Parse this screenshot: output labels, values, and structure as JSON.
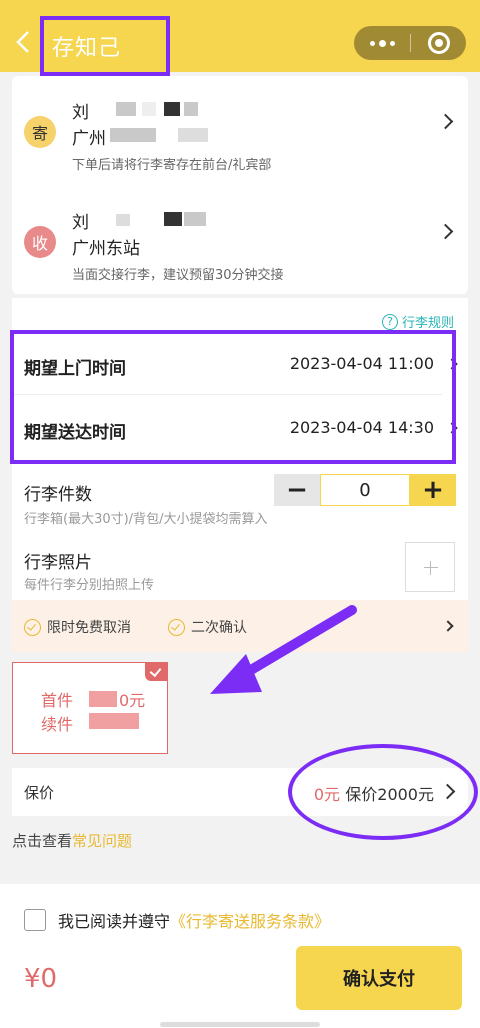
{
  "header": {
    "title": "存知己",
    "back_icon": "chevron-left-icon",
    "more_icon": "more-dots-icon",
    "close_icon": "target-close-icon",
    "bg_color": "#f6d54f"
  },
  "sender": {
    "badge": "寄",
    "name": "刘",
    "place": "广州",
    "note": "下单后请将行李寄存在前台/礼宾部",
    "badge_color": "#f5d36a"
  },
  "receiver": {
    "badge": "收",
    "name": "刘",
    "place": "广州东站",
    "note": "当面交接行李，建议预留30分钟交接",
    "badge_color": "#e88a8a"
  },
  "rules_link": "行李规则",
  "pickup": {
    "label": "期望上门时间",
    "value": "2023-04-04 11:00"
  },
  "delivery": {
    "label": "期望送达时间",
    "value": "2023-04-04 14:30"
  },
  "luggage": {
    "count_label": "行李件数",
    "count_sub": "行李箱(最大30寸)/背包/大小提袋均需算入",
    "count_value": "0",
    "minus": "−",
    "plus": "+",
    "photo_label": "行李照片",
    "photo_sub": "每件行李分别拍照上传"
  },
  "perks": [
    "限时免费取消",
    "二次确认"
  ],
  "coupon": {
    "line1": "首件",
    "line1_tail": "0元",
    "line2": "续件"
  },
  "insurance": {
    "label": "保价",
    "zero": "0元",
    "value": "保价2000元"
  },
  "faq": {
    "prefix": "点击查看",
    "link": "常见问题"
  },
  "agreement": {
    "prefix": "我已阅读并遵守",
    "terms": "《行李寄送服务条款》"
  },
  "price": "¥0",
  "pay_button": "确认支付",
  "annotation_color": "#7b2cf5"
}
